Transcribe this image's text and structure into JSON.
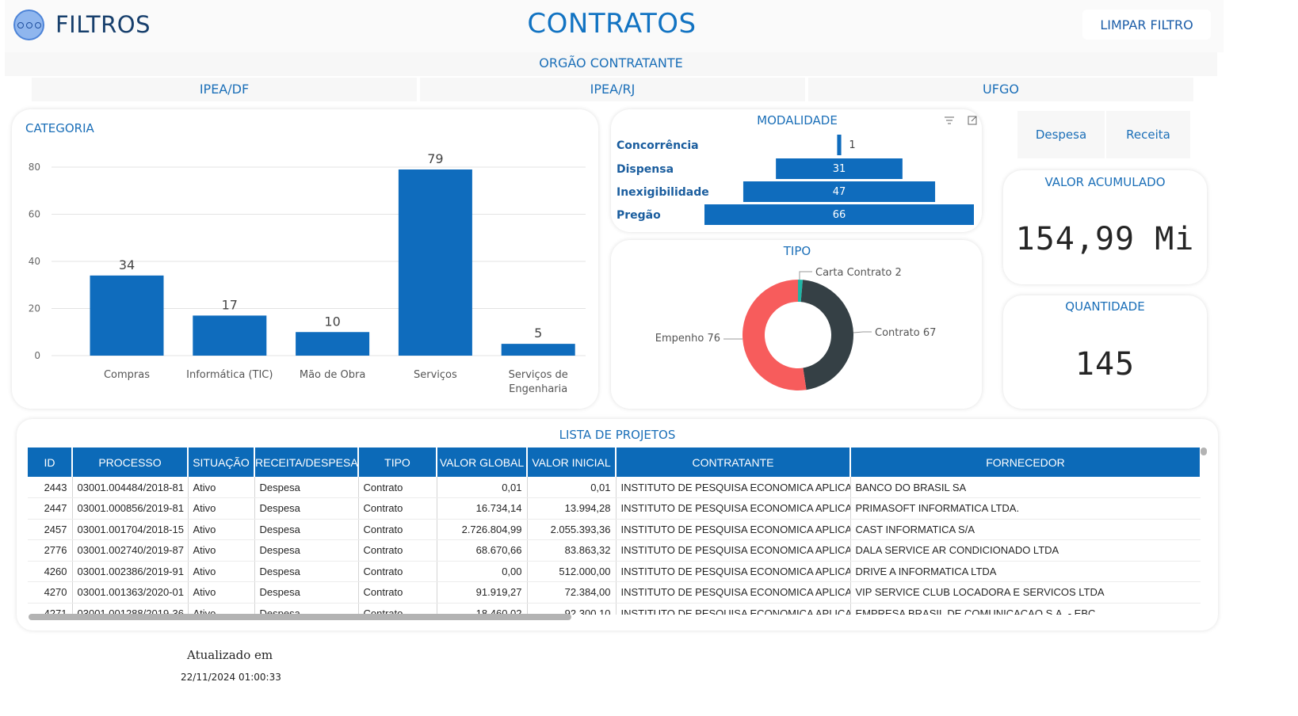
{
  "header": {
    "filtros_label": "FILTROS",
    "title": "CONTRATOS",
    "clear_button": "LIMPAR FILTRO"
  },
  "orgao": {
    "label": "ORGÃO CONTRATANTE",
    "options": [
      "IPEA/DF",
      "IPEA/RJ",
      "UFGO"
    ]
  },
  "categoria": {
    "title": "CATEGORIA",
    "chart_data": {
      "type": "bar",
      "categories": [
        "Compras",
        "Informática (TIC)",
        "Mão de Obra",
        "Serviços",
        "Serviços de Engenharia"
      ],
      "category_lines": [
        [
          "Compras"
        ],
        [
          "Informática (TIC)"
        ],
        [
          "Mão de Obra"
        ],
        [
          "Serviços"
        ],
        [
          "Serviços de",
          "Engenharia"
        ]
      ],
      "values": [
        34,
        17,
        10,
        79,
        5
      ],
      "ylim": [
        0,
        80
      ],
      "yticks": [
        0,
        20,
        40,
        60,
        80
      ],
      "grid": true,
      "color": "#0f6cbd"
    }
  },
  "modalidade": {
    "title": "MODALIDADE",
    "chart_data": {
      "type": "bar",
      "categories": [
        "Concorrência",
        "Dispensa",
        "Inexigibilidade",
        "Pregão"
      ],
      "values": [
        1,
        31,
        47,
        66
      ],
      "color": "#0f6cbd"
    }
  },
  "tipo": {
    "title": "TIPO",
    "chart_data": {
      "type": "pie",
      "labels": [
        "Carta Contrato",
        "Contrato",
        "Empenho"
      ],
      "values": [
        2,
        67,
        76
      ],
      "colors": [
        "#1fb5a5",
        "#354045",
        "#f75c5c"
      ]
    }
  },
  "tipo_filter": {
    "options": [
      "Despesa",
      "Receita"
    ]
  },
  "kpis": {
    "valor": {
      "title": "VALOR ACUMULADO",
      "value": "154,99 Mi"
    },
    "quantidade": {
      "title": "QUANTIDADE",
      "value": "145"
    }
  },
  "table": {
    "title": "LISTA DE PROJETOS",
    "columns": [
      "ID",
      "PROCESSO",
      "SITUAÇÃO",
      "RECEITA/DESPESA",
      "TIPO",
      "VALOR GLOBAL",
      "VALOR INICIAL",
      "CONTRATANTE",
      "FORNECEDOR"
    ],
    "rows": [
      [
        "2443",
        "03001.004484/2018-81",
        "Ativo",
        "Despesa",
        "Contrato",
        "0,01",
        "0,01",
        "INSTITUTO DE PESQUISA ECONOMICA APLICADA",
        "BANCO DO BRASIL SA"
      ],
      [
        "2447",
        "03001.000856/2019-81",
        "Ativo",
        "Despesa",
        "Contrato",
        "16.734,14",
        "13.994,28",
        "INSTITUTO DE PESQUISA ECONOMICA APLICADA",
        "PRIMASOFT INFORMATICA LTDA."
      ],
      [
        "2457",
        "03001.001704/2018-15",
        "Ativo",
        "Despesa",
        "Contrato",
        "2.726.804,99",
        "2.055.393,36",
        "INSTITUTO DE PESQUISA ECONOMICA APLICADA",
        "CAST INFORMATICA S/A"
      ],
      [
        "2776",
        "03001.002740/2019-87",
        "Ativo",
        "Despesa",
        "Contrato",
        "68.670,66",
        "83.863,32",
        "INSTITUTO DE PESQUISA ECONOMICA APLICADA",
        "DALA SERVICE AR CONDICIONADO LTDA"
      ],
      [
        "4260",
        "03001.002386/2019-91",
        "Ativo",
        "Despesa",
        "Contrato",
        "0,00",
        "512.000,00",
        "INSTITUTO DE PESQUISA ECONOMICA APLICADA",
        "DRIVE A INFORMATICA LTDA"
      ],
      [
        "4270",
        "03001.001363/2020-01",
        "Ativo",
        "Despesa",
        "Contrato",
        "91.919,27",
        "72.384,00",
        "INSTITUTO DE PESQUISA ECONOMICA APLICADA",
        "VIP SERVICE CLUB LOCADORA E SERVICOS LTDA"
      ],
      [
        "4271",
        "03001.001288/2019-36",
        "Ativo",
        "Despesa",
        "Contrato",
        "18.460,02",
        "92.300,10",
        "INSTITUTO DE PESQUISA ECONOMICA APLICADA",
        "EMPRESA BRASIL DE COMUNICACAO S.A. - EBC"
      ]
    ]
  },
  "footer": {
    "label": "Atualizado em",
    "timestamp": "22/11/2024 01:00:33"
  }
}
